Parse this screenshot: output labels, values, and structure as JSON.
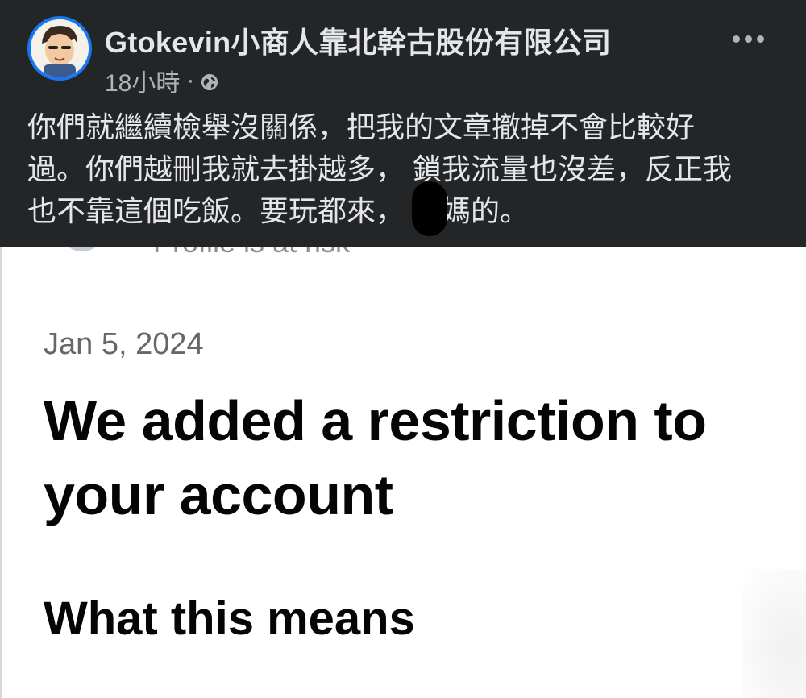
{
  "post": {
    "author": "Gtokevin小商人靠北幹古股份有限公司",
    "time": "18小時",
    "separator": "·",
    "audience_icon": "globe-icon",
    "more_icon": "more-options-icon",
    "text_lines": [
      "你們就繼續檢舉沒關係，把我的文章撤掉不會比較好",
      "過。你們越刪我就去掛越多， 鎖我流量也沒差，反正我",
      "也不靠這個吃飯。要玩都來，   你媽的。"
    ]
  },
  "screenshot": {
    "cut_label": "Profile is at risk",
    "date": "Jan 5, 2024",
    "heading": "We added a restriction to your account",
    "subheading": "What this means"
  },
  "colors": {
    "dark_bg": "#242526",
    "text_primary_dark": "#e4e6eb",
    "text_secondary_dark": "#b0b3b8",
    "avatar_ring": "#1877f2",
    "light_bg": "#ffffff",
    "heading_text": "#050505",
    "date_text": "#65676b"
  }
}
